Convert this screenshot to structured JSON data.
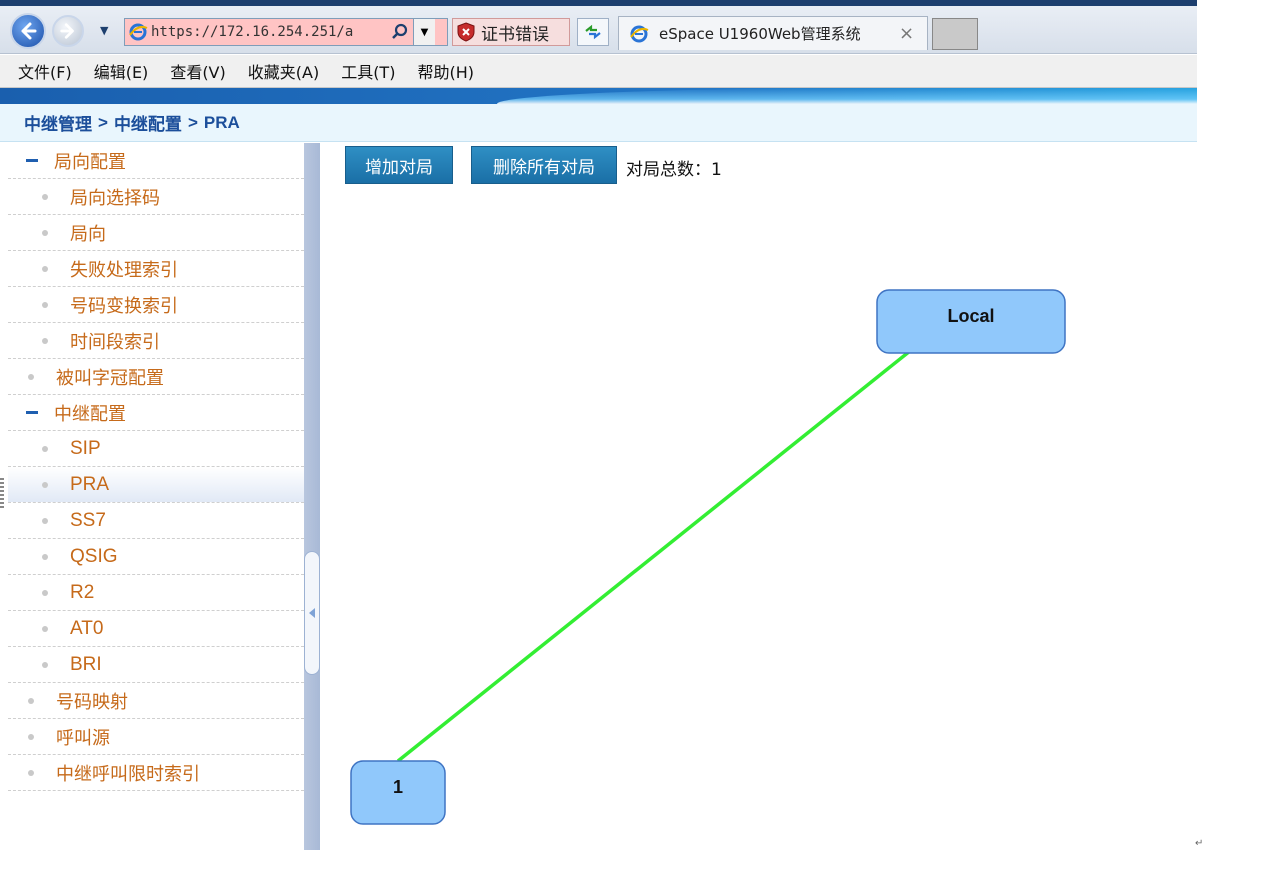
{
  "browser": {
    "address_url": "https://172.16.254.251/a",
    "cert_error_label": "证书错误",
    "tab_title": "eSpace U1960Web管理系统",
    "tab_close": "×"
  },
  "menubar": {
    "items": [
      "文件(F)",
      "编辑(E)",
      "查看(V)",
      "收藏夹(A)",
      "工具(T)",
      "帮助(H)"
    ]
  },
  "breadcrumb": {
    "items": [
      "中继管理",
      "中继配置",
      "PRA"
    ],
    "separator": ">"
  },
  "sidebar": {
    "items": [
      {
        "label": "局向配置",
        "level": 1,
        "expanded": true
      },
      {
        "label": "局向选择码",
        "level": 2
      },
      {
        "label": "局向",
        "level": 2
      },
      {
        "label": "失败处理索引",
        "level": 2
      },
      {
        "label": "号码变换索引",
        "level": 2
      },
      {
        "label": "时间段索引",
        "level": 2
      },
      {
        "label": "被叫字冠配置",
        "level": 1
      },
      {
        "label": "中继配置",
        "level": 1,
        "expanded": true
      },
      {
        "label": "SIP",
        "level": 2
      },
      {
        "label": "PRA",
        "level": 2,
        "active": true
      },
      {
        "label": "SS7",
        "level": 2
      },
      {
        "label": "QSIG",
        "level": 2
      },
      {
        "label": "R2",
        "level": 2
      },
      {
        "label": "AT0",
        "level": 2
      },
      {
        "label": "BRI",
        "level": 2
      },
      {
        "label": "号码映射",
        "level": 1
      },
      {
        "label": "呼叫源",
        "level": 1
      },
      {
        "label": "中继呼叫限时索引",
        "level": 1
      }
    ]
  },
  "main": {
    "add_button": "增加对局",
    "delete_all_button": "删除所有对局",
    "count_label": "对局总数：",
    "count_value": "1"
  },
  "topology": {
    "nodes": {
      "local": {
        "label": "Local"
      },
      "office1": {
        "label": "1"
      }
    },
    "link_color": "#33ee33",
    "node_color": "#90c8fb"
  },
  "colors": {
    "accent": "#1a6fa6",
    "nav_text": "#c66a1a",
    "breadcrumb_text": "#1c4f9b"
  },
  "footer_mark": "↵"
}
